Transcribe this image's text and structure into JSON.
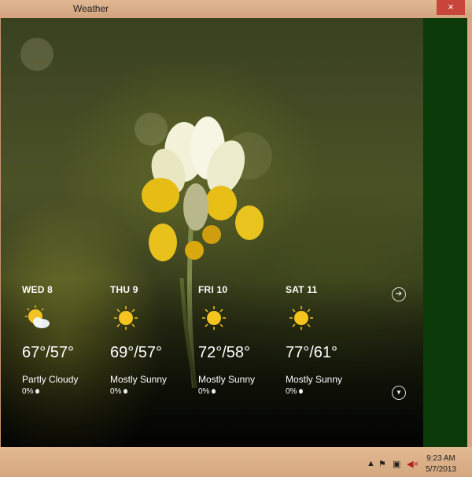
{
  "window": {
    "title": "Weather",
    "close_glyph": "×"
  },
  "forecast": [
    {
      "day": "WED 8",
      "icon": "partly-cloudy-icon",
      "temps": "67°/57°",
      "condition": "Partly Cloudy",
      "precip": "0%"
    },
    {
      "day": "THU 9",
      "icon": "sun-icon",
      "temps": "69°/57°",
      "condition": "Mostly Sunny",
      "precip": "0%"
    },
    {
      "day": "FRI 10",
      "icon": "sun-icon",
      "temps": "72°/58°",
      "condition": "Mostly Sunny",
      "precip": "0%"
    },
    {
      "day": "SAT 11",
      "icon": "sun-icon",
      "temps": "77°/61°",
      "condition": "Mostly Sunny",
      "precip": "0%"
    }
  ],
  "nav": {
    "next_glyph": "➔",
    "down_glyph": "▼"
  },
  "taskbar": {
    "tray_icons": [
      "up-arrow-icon",
      "flag-icon",
      "network-icon",
      "volume-muted-icon"
    ],
    "time": "9:23 AM",
    "date": "5/7/2013"
  },
  "colors": {
    "side_panel": "#0b3a08",
    "chrome": "#d5a883",
    "close_button": "#c7453a"
  }
}
